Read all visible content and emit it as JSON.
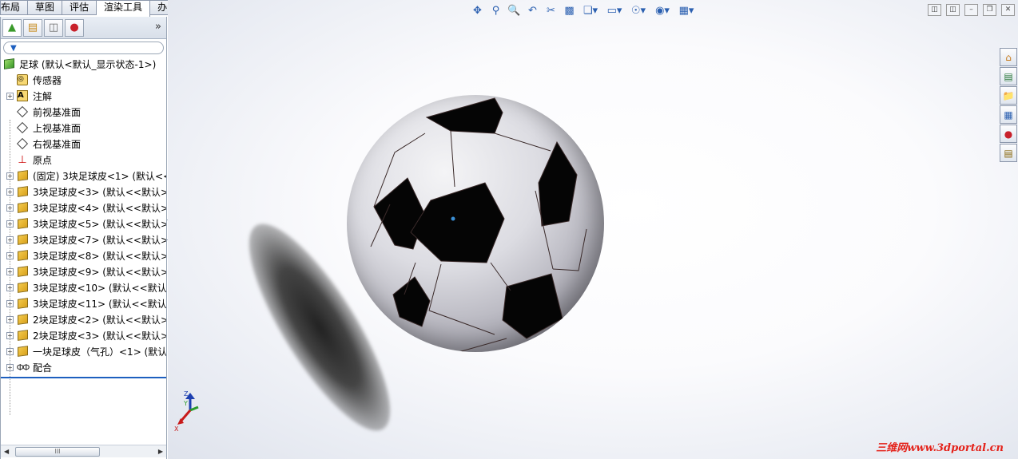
{
  "tabs": [
    "布局",
    "草图",
    "评估",
    "渲染工具",
    "办公室产品"
  ],
  "active_tab": "渲染工具",
  "panel_tabs": [
    "feature-manager",
    "property-manager",
    "configuration-manager",
    "display-manager"
  ],
  "expand_glyph": "»",
  "tree": {
    "root": "足球  (默认<默认_显示状态-1>)",
    "items": [
      {
        "label": "传感器",
        "icon": "sensor-icon",
        "expand": false
      },
      {
        "label": "注解",
        "icon": "annotation-icon",
        "expand": true
      },
      {
        "label": "前视基准面",
        "icon": "plane-icon",
        "expand": false
      },
      {
        "label": "上视基准面",
        "icon": "plane-icon",
        "expand": false
      },
      {
        "label": "右视基准面",
        "icon": "plane-icon",
        "expand": false
      },
      {
        "label": "原点",
        "icon": "origin-icon",
        "expand": false
      },
      {
        "label": "(固定) 3块足球皮<1> (默认<<",
        "icon": "part-icon",
        "expand": true
      },
      {
        "label": "3块足球皮<3>  (默认<<默认>",
        "icon": "part-icon",
        "expand": true
      },
      {
        "label": "3块足球皮<4>  (默认<<默认>",
        "icon": "part-icon",
        "expand": true
      },
      {
        "label": "3块足球皮<5>  (默认<<默认>",
        "icon": "part-icon",
        "expand": true
      },
      {
        "label": "3块足球皮<7>  (默认<<默认>",
        "icon": "part-icon",
        "expand": true
      },
      {
        "label": "3块足球皮<8>  (默认<<默认>",
        "icon": "part-icon",
        "expand": true
      },
      {
        "label": "3块足球皮<9>  (默认<<默认>",
        "icon": "part-icon",
        "expand": true
      },
      {
        "label": "3块足球皮<10>  (默认<<默认",
        "icon": "part-icon",
        "expand": true
      },
      {
        "label": "3块足球皮<11>  (默认<<默认",
        "icon": "part-icon",
        "expand": true
      },
      {
        "label": "2块足球皮<2>  (默认<<默认>",
        "icon": "part-icon",
        "expand": true
      },
      {
        "label": "2块足球皮<3>  (默认<<默认>",
        "icon": "part-icon",
        "expand": true
      },
      {
        "label": "一块足球皮（气孔）<1>  (默认",
        "icon": "part-icon",
        "expand": true
      },
      {
        "label": "配合",
        "icon": "mate-icon",
        "expand": true
      }
    ]
  },
  "scroll_thumb_glyph": "III",
  "triad_labels": {
    "z": "Z",
    "y": "Y",
    "x": "X"
  },
  "watermark": "三维网www.3dportal.cn",
  "colors": {
    "accent": "#1d5fbf",
    "watermark": "#e4221a"
  }
}
